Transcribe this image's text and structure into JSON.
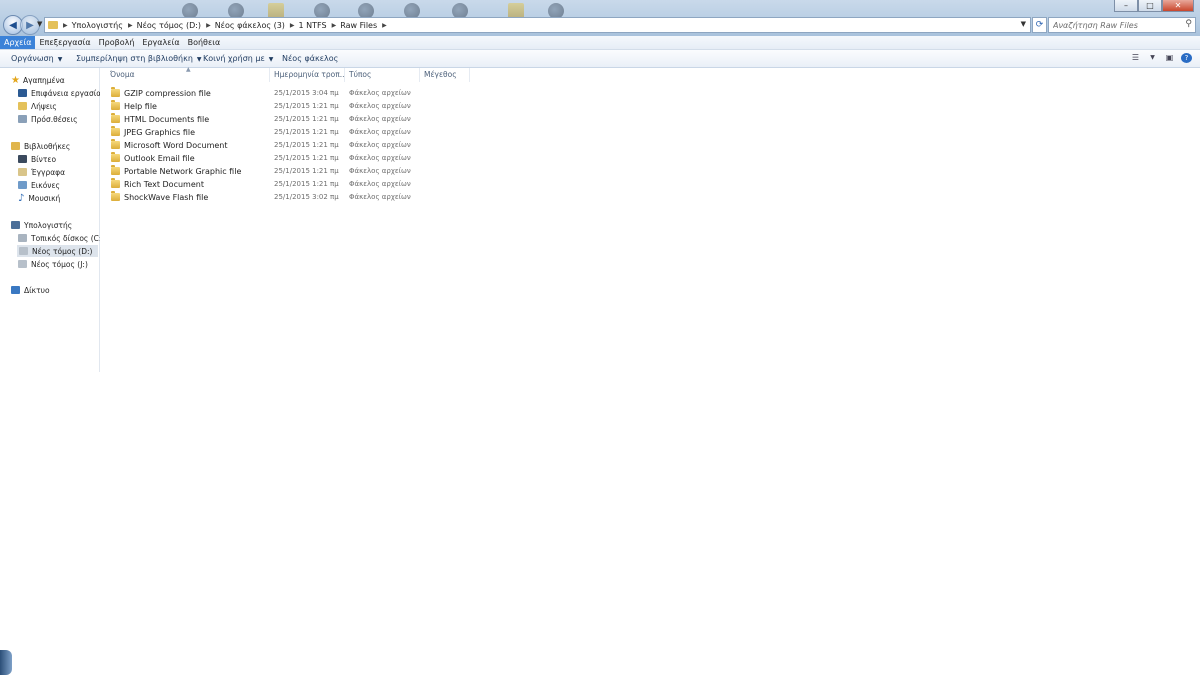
{
  "window": {
    "controls": {
      "minimize": "–",
      "maximize": "□",
      "close": "✕"
    }
  },
  "navigation": {
    "back_glyph": "◀",
    "forward_glyph": "▶",
    "breadcrumb": [
      "Υπολογιστής",
      "Νέος τόμος (D:)",
      "Νέος φάκελος (3)",
      "1 NTFS",
      "Raw Files"
    ],
    "search_placeholder": "Αναζήτηση Raw Files"
  },
  "menu": [
    "Αρχεία",
    "Επεξεργασία",
    "Προβολή",
    "Εργαλεία",
    "Βοήθεια"
  ],
  "commands": {
    "organize": "Οργάνωση",
    "include_library": "Συμπερίληψη στη βιβλιοθήκη",
    "share_with": "Κοινή χρήση με",
    "new_folder": "Νέος φάκελος"
  },
  "sidebar": {
    "favorites": {
      "label": "Αγαπημένα",
      "items": [
        "Επιφάνεια εργασίας",
        "Λήψεις",
        "Πρόσ.θέσεις"
      ]
    },
    "libraries": {
      "label": "Βιβλιοθήκες",
      "items": [
        "Βίντεο",
        "Έγγραφα",
        "Εικόνες",
        "Μουσική"
      ]
    },
    "computer": {
      "label": "Υπολογιστής",
      "items": [
        "Τοπικός δίσκος (C:)",
        "Νέος τόμος (D:)",
        "Νέος τόμος (J:)"
      ]
    },
    "network": {
      "label": "Δίκτυο"
    }
  },
  "columns": [
    "Όνομα",
    "Ημερομηνία τροπ...",
    "Τύπος",
    "Μέγεθος"
  ],
  "files": [
    {
      "name": "GZIP compression file",
      "date": "25/1/2015 3:04 πμ",
      "type": "Φάκελος αρχείων"
    },
    {
      "name": "Help file",
      "date": "25/1/2015 1:21 πμ",
      "type": "Φάκελος αρχείων"
    },
    {
      "name": "HTML Documents file",
      "date": "25/1/2015 1:21 πμ",
      "type": "Φάκελος αρχείων"
    },
    {
      "name": "JPEG Graphics file",
      "date": "25/1/2015 1:21 πμ",
      "type": "Φάκελος αρχείων"
    },
    {
      "name": "Microsoft Word Document",
      "date": "25/1/2015 1:21 πμ",
      "type": "Φάκελος αρχείων"
    },
    {
      "name": "Outlook Email file",
      "date": "25/1/2015 1:21 πμ",
      "type": "Φάκελος αρχείων"
    },
    {
      "name": "Portable Network Graphic file",
      "date": "25/1/2015 1:21 πμ",
      "type": "Φάκελος αρχείων"
    },
    {
      "name": "Rich Text Document",
      "date": "25/1/2015 1:21 πμ",
      "type": "Φάκελος αρχείων"
    },
    {
      "name": "ShockWave Flash file",
      "date": "25/1/2015 3:02 πμ",
      "type": "Φάκελος αρχείων"
    }
  ]
}
